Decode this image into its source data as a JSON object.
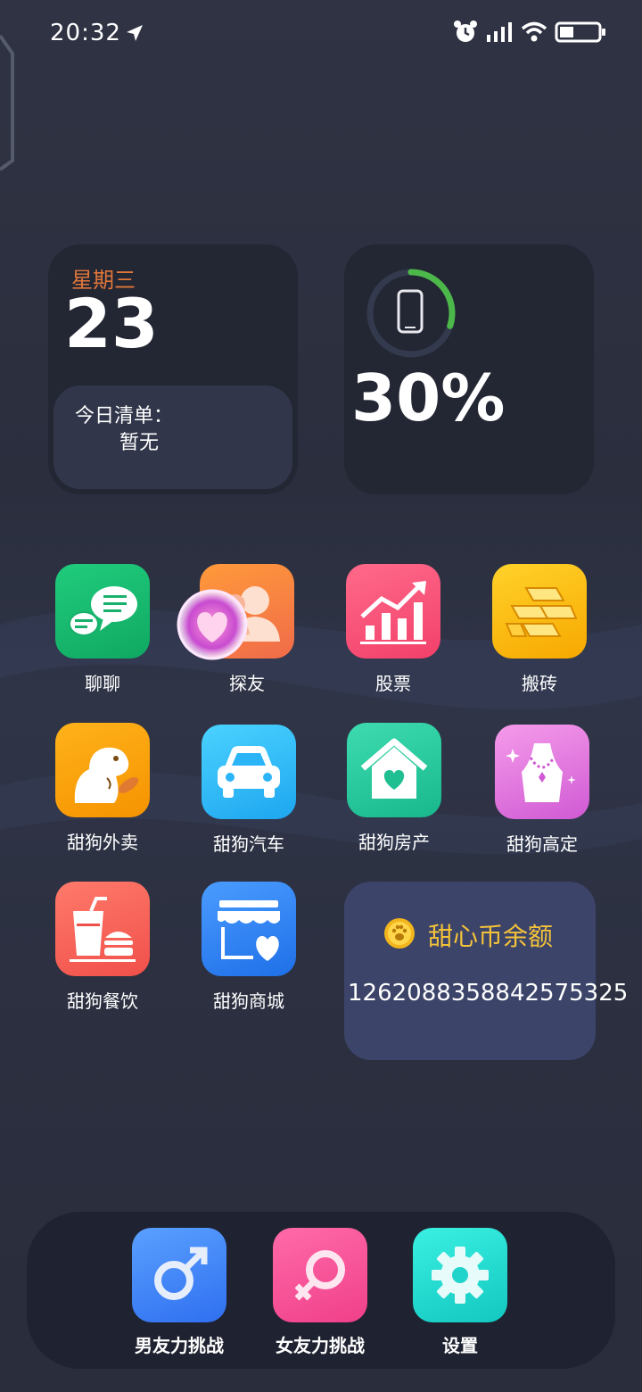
{
  "status_bar": {
    "time": "20:32"
  },
  "date_widget": {
    "weekday": "星期三",
    "day": "23",
    "todo_title": "今日清单：",
    "todo_value": "暂无"
  },
  "battery_widget": {
    "percent_text": "30%",
    "level": 0.3,
    "ring_color": "#4cb84a"
  },
  "apps": {
    "chat": "聊聊",
    "friends": "探友",
    "stocks": "股票",
    "bricks": "搬砖",
    "takeout": "甜狗外卖",
    "car": "甜狗汽车",
    "realestate": "甜狗房产",
    "luxury": "甜狗高定",
    "dining": "甜狗餐饮",
    "mall": "甜狗商城"
  },
  "coin_widget": {
    "title": "甜心币余额",
    "balance": "1262088358842575325"
  },
  "dock": {
    "boyfriend": "男友力挑战",
    "girlfriend": "女友力挑战",
    "settings": "设置"
  },
  "colors": {
    "accent_orange": "#e0763a",
    "coin_yellow": "#f5c33a",
    "battery_green": "#4cb84a"
  }
}
